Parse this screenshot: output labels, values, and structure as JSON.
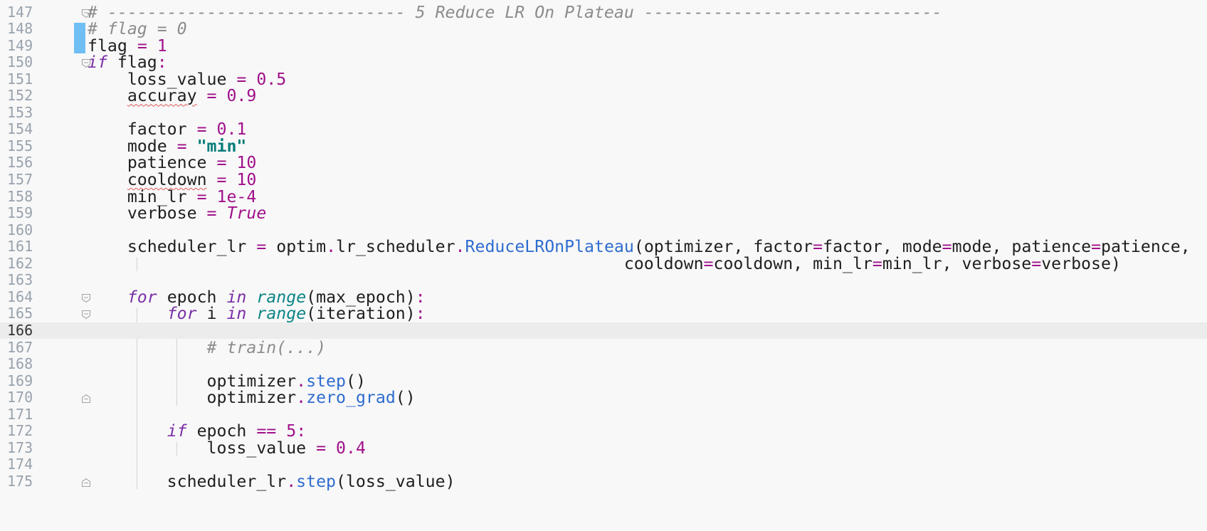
{
  "editor": {
    "name": "code-editor",
    "colors": {
      "background": "#f8f8f8",
      "current_line": "#ececec",
      "line_number": "#98a2ad",
      "text": "#1f1f1f",
      "keyword": "#7a2fa6",
      "number": "#a0108a",
      "string": "#067d7a",
      "builtin": "#0d8585",
      "method": "#2f6ccf",
      "comment": "#8c8c8c",
      "change_marker": "#6fbef4",
      "typo_underline": "#e05656"
    },
    "current_line_number": "166",
    "lines": [
      {
        "num": "147",
        "tokens": [
          {
            "t": "# ------------------------------ 5 Reduce LR On Plateau ------------------------------",
            "c": "comment"
          }
        ]
      },
      {
        "num": "148",
        "tokens": [
          {
            "t": "# flag = 0",
            "c": "comment"
          }
        ]
      },
      {
        "num": "149",
        "tokens": [
          {
            "t": "flag ",
            "c": "plain"
          },
          {
            "t": "=",
            "c": "op"
          },
          {
            "t": " 1",
            "c": "num"
          }
        ]
      },
      {
        "num": "150",
        "tokens": [
          {
            "t": "if",
            "c": "kw"
          },
          {
            "t": " flag",
            "c": "plain"
          },
          {
            "t": ":",
            "c": "op"
          }
        ]
      },
      {
        "num": "151",
        "tokens": [
          {
            "t": "    loss_value ",
            "c": "plain"
          },
          {
            "t": "=",
            "c": "op"
          },
          {
            "t": " 0.5",
            "c": "num"
          }
        ]
      },
      {
        "num": "152",
        "tokens": [
          {
            "t": "    ",
            "c": "plain"
          },
          {
            "t": "accuray",
            "c": "plain",
            "w": true
          },
          {
            "t": " ",
            "c": "plain"
          },
          {
            "t": "=",
            "c": "op"
          },
          {
            "t": " 0.9",
            "c": "num"
          }
        ]
      },
      {
        "num": "153",
        "tokens": []
      },
      {
        "num": "154",
        "tokens": [
          {
            "t": "    factor ",
            "c": "plain"
          },
          {
            "t": "=",
            "c": "op"
          },
          {
            "t": " 0.1",
            "c": "num"
          }
        ]
      },
      {
        "num": "155",
        "tokens": [
          {
            "t": "    mode ",
            "c": "plain"
          },
          {
            "t": "=",
            "c": "op"
          },
          {
            "t": " ",
            "c": "plain"
          },
          {
            "t": "\"min\"",
            "c": "str"
          }
        ]
      },
      {
        "num": "156",
        "tokens": [
          {
            "t": "    patience ",
            "c": "plain"
          },
          {
            "t": "=",
            "c": "op"
          },
          {
            "t": " 10",
            "c": "num"
          }
        ]
      },
      {
        "num": "157",
        "tokens": [
          {
            "t": "    ",
            "c": "plain"
          },
          {
            "t": "cooldown",
            "c": "plain",
            "w": true
          },
          {
            "t": " ",
            "c": "plain"
          },
          {
            "t": "=",
            "c": "op"
          },
          {
            "t": " 10",
            "c": "num"
          }
        ]
      },
      {
        "num": "158",
        "tokens": [
          {
            "t": "    min_lr ",
            "c": "plain"
          },
          {
            "t": "=",
            "c": "op"
          },
          {
            "t": " 1e-4",
            "c": "num"
          }
        ]
      },
      {
        "num": "159",
        "tokens": [
          {
            "t": "    verbose ",
            "c": "plain"
          },
          {
            "t": "=",
            "c": "op"
          },
          {
            "t": " ",
            "c": "plain"
          },
          {
            "t": "True",
            "c": "const"
          }
        ]
      },
      {
        "num": "160",
        "tokens": []
      },
      {
        "num": "161",
        "tokens": [
          {
            "t": "    scheduler_lr ",
            "c": "plain"
          },
          {
            "t": "=",
            "c": "op"
          },
          {
            "t": " optim",
            "c": "plain"
          },
          {
            "t": ".",
            "c": "op"
          },
          {
            "t": "lr_scheduler",
            "c": "plain"
          },
          {
            "t": ".",
            "c": "op"
          },
          {
            "t": "ReduceLROnPlateau",
            "c": "method"
          },
          {
            "t": "(optimizer, factor",
            "c": "plain"
          },
          {
            "t": "=",
            "c": "op"
          },
          {
            "t": "factor, mode",
            "c": "plain"
          },
          {
            "t": "=",
            "c": "op"
          },
          {
            "t": "mode, patience",
            "c": "plain"
          },
          {
            "t": "=",
            "c": "op"
          },
          {
            "t": "patience,",
            "c": "plain"
          }
        ]
      },
      {
        "num": "162",
        "tokens": [
          {
            "t": "                                                      cooldown",
            "c": "plain"
          },
          {
            "t": "=",
            "c": "op"
          },
          {
            "t": "cooldown, min_lr",
            "c": "plain"
          },
          {
            "t": "=",
            "c": "op"
          },
          {
            "t": "min_lr, verbose",
            "c": "plain"
          },
          {
            "t": "=",
            "c": "op"
          },
          {
            "t": "verbose)",
            "c": "plain"
          }
        ]
      },
      {
        "num": "163",
        "tokens": []
      },
      {
        "num": "164",
        "tokens": [
          {
            "t": "    ",
            "c": "plain"
          },
          {
            "t": "for",
            "c": "kw"
          },
          {
            "t": " epoch ",
            "c": "plain"
          },
          {
            "t": "in",
            "c": "kw"
          },
          {
            "t": " ",
            "c": "plain"
          },
          {
            "t": "range",
            "c": "builtin"
          },
          {
            "t": "(max_epoch)",
            "c": "plain"
          },
          {
            "t": ":",
            "c": "op"
          }
        ]
      },
      {
        "num": "165",
        "tokens": [
          {
            "t": "        ",
            "c": "plain"
          },
          {
            "t": "for",
            "c": "kw"
          },
          {
            "t": " i ",
            "c": "plain"
          },
          {
            "t": "in",
            "c": "kw"
          },
          {
            "t": " ",
            "c": "plain"
          },
          {
            "t": "range",
            "c": "builtin"
          },
          {
            "t": "(iteration)",
            "c": "plain"
          },
          {
            "t": ":",
            "c": "op"
          }
        ]
      },
      {
        "num": "166",
        "tokens": []
      },
      {
        "num": "167",
        "tokens": [
          {
            "t": "            ",
            "c": "plain"
          },
          {
            "t": "# train(...)",
            "c": "comment"
          }
        ]
      },
      {
        "num": "168",
        "tokens": []
      },
      {
        "num": "169",
        "tokens": [
          {
            "t": "            optimizer",
            "c": "plain"
          },
          {
            "t": ".",
            "c": "op"
          },
          {
            "t": "step",
            "c": "method"
          },
          {
            "t": "()",
            "c": "plain"
          }
        ]
      },
      {
        "num": "170",
        "tokens": [
          {
            "t": "            optimizer",
            "c": "plain"
          },
          {
            "t": ".",
            "c": "op"
          },
          {
            "t": "zero_grad",
            "c": "method"
          },
          {
            "t": "()",
            "c": "plain"
          }
        ]
      },
      {
        "num": "171",
        "tokens": []
      },
      {
        "num": "172",
        "tokens": [
          {
            "t": "        ",
            "c": "plain"
          },
          {
            "t": "if",
            "c": "kw"
          },
          {
            "t": " epoch ",
            "c": "plain"
          },
          {
            "t": "==",
            "c": "op"
          },
          {
            "t": " 5",
            "c": "num"
          },
          {
            "t": ":",
            "c": "op"
          }
        ]
      },
      {
        "num": "173",
        "tokens": [
          {
            "t": "            loss_value ",
            "c": "plain"
          },
          {
            "t": "=",
            "c": "op"
          },
          {
            "t": " 0.4",
            "c": "num"
          }
        ]
      },
      {
        "num": "174",
        "tokens": []
      },
      {
        "num": "175",
        "tokens": [
          {
            "t": "        scheduler_lr",
            "c": "plain"
          },
          {
            "t": ".",
            "c": "op"
          },
          {
            "t": "step",
            "c": "method"
          },
          {
            "t": "(loss_value)",
            "c": "plain"
          }
        ]
      }
    ]
  },
  "gutter": {
    "fold_open_lines": [
      "147",
      "150",
      "164",
      "165"
    ],
    "fold_close_lines": [
      "170",
      "175"
    ],
    "changed_lines": [
      "148",
      "149"
    ],
    "fold_icon": "fold-arrow-icon",
    "fold_end_icon": "fold-end-icon",
    "change_icon": "change-marker"
  }
}
